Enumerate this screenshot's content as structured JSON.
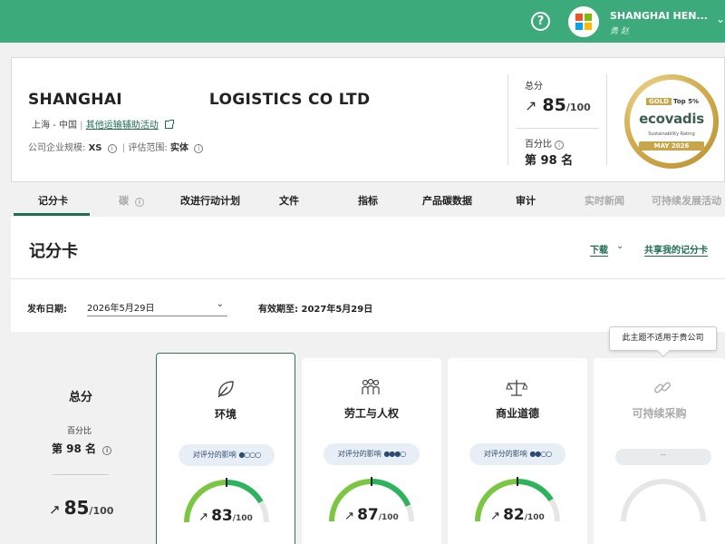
{
  "topbar": {
    "help_icon": "question-circle-icon",
    "user_name": "SHANGHAI HEN...",
    "user_sub": "勇 赵",
    "logo_colors": [
      "#f25022",
      "#7fba00",
      "#00a4ef",
      "#ffb900"
    ]
  },
  "company": {
    "name_part1": "SHANGHAI",
    "name_part2": "LOGISTICS CO LTD",
    "location": "上海 - 中国",
    "activity": "其他运输辅助活动",
    "size_label": "公司企业规模:",
    "size_value": "XS",
    "scope_label": "评估范围:",
    "scope_value": "实体"
  },
  "score_box": {
    "total_label": "总分",
    "score": "85",
    "denom": "/100",
    "percentile_label": "百分比",
    "rank": "第 98 名"
  },
  "medal": {
    "level": "GOLD",
    "top": "Top 5%",
    "brand": "ecovadis",
    "subtitle": "Sustainability Rating",
    "date": "MAY 2026"
  },
  "tabs": [
    {
      "label": "记分卡",
      "active": true
    },
    {
      "label": "碳",
      "disabled": true
    },
    {
      "label": "改进行动计划"
    },
    {
      "label": "文件"
    },
    {
      "label": "指标"
    },
    {
      "label": "产品碳数据"
    },
    {
      "label": "审计"
    },
    {
      "label": "实时新闻",
      "disabled": true
    },
    {
      "label": "可持续发展活动",
      "disabled": true
    }
  ],
  "scorecard": {
    "title": "记分卡",
    "download": "下载",
    "share": "共享我的记分卡",
    "publish_label": "发布日期:",
    "publish_value": "2026年5月29日",
    "expiry_label": "有效期至:",
    "expiry_value": "2027年5月29日"
  },
  "tooltip": "此主题不适用于贵公司",
  "overall": {
    "title": "总分",
    "percentile_label": "百分比",
    "rank": "第 98 名",
    "score": "85",
    "denom": "/100"
  },
  "themes": [
    {
      "title": "环境",
      "icon": "leaf-icon",
      "impact_label": "对评分的影响",
      "impact_level": 1,
      "score": 83,
      "denom": "/100"
    },
    {
      "title": "劳工与人权",
      "icon": "people-icon",
      "impact_label": "对评分的影响",
      "impact_level": 3,
      "score": 87,
      "denom": "/100"
    },
    {
      "title": "商业道德",
      "icon": "scales-icon",
      "impact_label": "对评分的影响",
      "impact_level": 2,
      "score": 82,
      "denom": "/100"
    },
    {
      "title": "可持续采购",
      "icon": "link-icon",
      "impact_label": "--",
      "not_applicable": true
    }
  ],
  "colors": {
    "brand_green": "#3daa7b",
    "link_green": "#1d6e52",
    "gauge_green": "#2db35b",
    "gauge_lime": "#7cc742",
    "gauge_track": "#e6e6e6"
  }
}
